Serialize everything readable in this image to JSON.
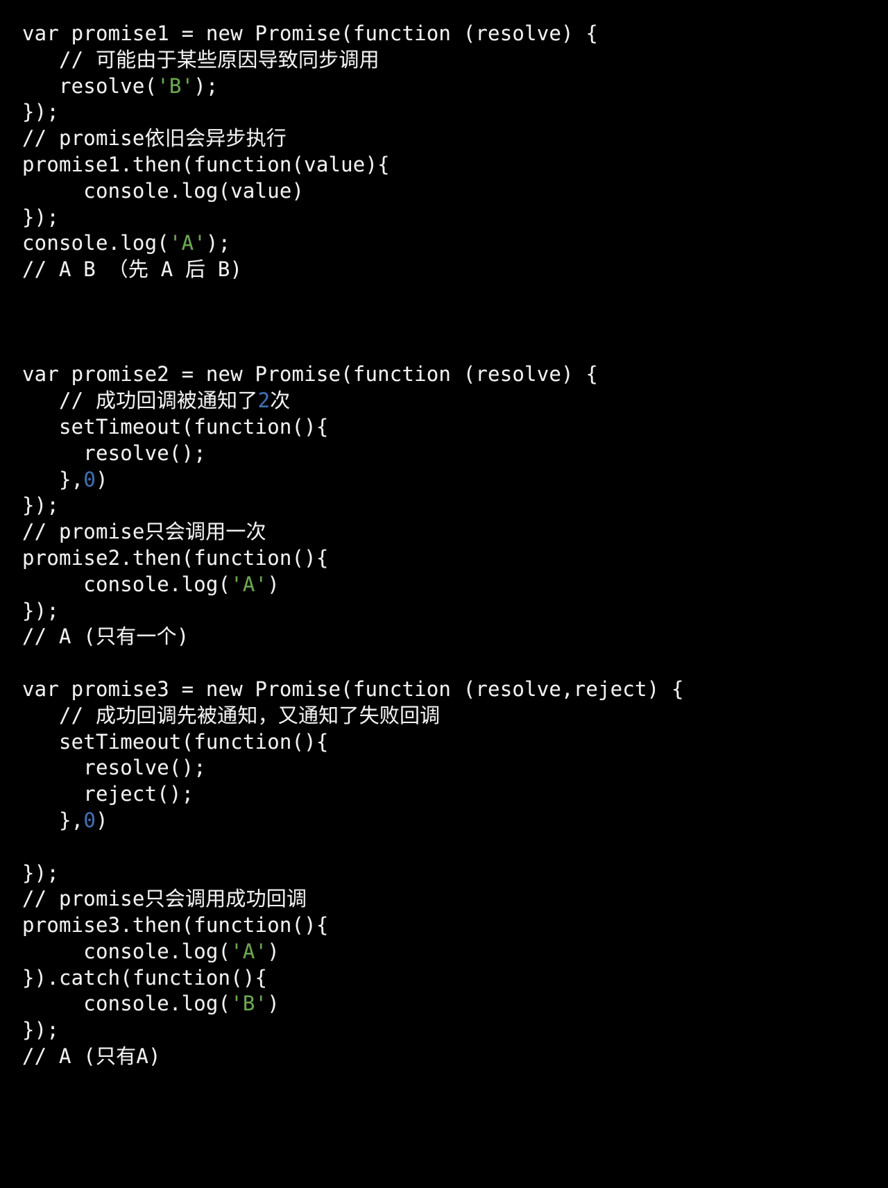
{
  "editor": {
    "background_color": "#000000",
    "foreground_color": "#f2f2f2",
    "string_color": "#6aa84f",
    "number_color": "#3d6fb5",
    "language": "javascript"
  },
  "code": {
    "lines": [
      {
        "id": "l1",
        "text": "var promise1 = new Promise(function (resolve) {"
      },
      {
        "id": "l2",
        "text": "   // 可能由于某些原因导致同步调用"
      },
      {
        "id": "l3",
        "text": "   resolve('B');",
        "segments": [
          {
            "t": "   resolve(",
            "k": "plain"
          },
          {
            "t": "'B'",
            "k": "str"
          },
          {
            "t": ");",
            "k": "plain"
          }
        ]
      },
      {
        "id": "l4",
        "text": "});"
      },
      {
        "id": "l5",
        "text": "// promise依旧会异步执行"
      },
      {
        "id": "l6",
        "text": "promise1.then(function(value){"
      },
      {
        "id": "l7",
        "text": "     console.log(value)"
      },
      {
        "id": "l8",
        "text": "});"
      },
      {
        "id": "l9",
        "text": "console.log('A');",
        "segments": [
          {
            "t": "console.log(",
            "k": "plain"
          },
          {
            "t": "'A'",
            "k": "str"
          },
          {
            "t": ");",
            "k": "plain"
          }
        ]
      },
      {
        "id": "l10",
        "text": "// A B （先 A 后 B)"
      },
      {
        "id": "l11",
        "text": ""
      },
      {
        "id": "l12",
        "text": ""
      },
      {
        "id": "l13",
        "text": ""
      },
      {
        "id": "l14",
        "text": "var promise2 = new Promise(function (resolve) {"
      },
      {
        "id": "l15",
        "text": "   // 成功回调被通知了2次",
        "segments": [
          {
            "t": "   // 成功回调被通知了",
            "k": "plain"
          },
          {
            "t": "2",
            "k": "num"
          },
          {
            "t": "次",
            "k": "plain"
          }
        ]
      },
      {
        "id": "l16",
        "text": "   setTimeout(function(){"
      },
      {
        "id": "l17",
        "text": "     resolve();"
      },
      {
        "id": "l18",
        "text": "   },0)",
        "segments": [
          {
            "t": "   },",
            "k": "plain"
          },
          {
            "t": "0",
            "k": "num"
          },
          {
            "t": ")",
            "k": "plain"
          }
        ]
      },
      {
        "id": "l19",
        "text": "});"
      },
      {
        "id": "l20",
        "text": "// promise只会调用一次"
      },
      {
        "id": "l21",
        "text": "promise2.then(function(){"
      },
      {
        "id": "l22",
        "text": "     console.log('A')",
        "segments": [
          {
            "t": "     console.log(",
            "k": "plain"
          },
          {
            "t": "'A'",
            "k": "str"
          },
          {
            "t": ")",
            "k": "plain"
          }
        ]
      },
      {
        "id": "l23",
        "text": "});"
      },
      {
        "id": "l24",
        "text": "// A (只有一个)"
      },
      {
        "id": "l25",
        "text": ""
      },
      {
        "id": "l26",
        "text": "var promise3 = new Promise(function (resolve,reject) {"
      },
      {
        "id": "l27",
        "text": "   // 成功回调先被通知，又通知了失败回调"
      },
      {
        "id": "l28",
        "text": "   setTimeout(function(){"
      },
      {
        "id": "l29",
        "text": "     resolve();"
      },
      {
        "id": "l30",
        "text": "     reject();"
      },
      {
        "id": "l31",
        "text": "   },0)",
        "segments": [
          {
            "t": "   },",
            "k": "plain"
          },
          {
            "t": "0",
            "k": "num"
          },
          {
            "t": ")",
            "k": "plain"
          }
        ]
      },
      {
        "id": "l32",
        "text": ""
      },
      {
        "id": "l33",
        "text": "});"
      },
      {
        "id": "l34",
        "text": "// promise只会调用成功回调"
      },
      {
        "id": "l35",
        "text": "promise3.then(function(){"
      },
      {
        "id": "l36",
        "text": "     console.log('A')",
        "segments": [
          {
            "t": "     console.log(",
            "k": "plain"
          },
          {
            "t": "'A'",
            "k": "str"
          },
          {
            "t": ")",
            "k": "plain"
          }
        ]
      },
      {
        "id": "l37",
        "text": "}).catch(function(){"
      },
      {
        "id": "l38",
        "text": "     console.log('B')",
        "segments": [
          {
            "t": "     console.log(",
            "k": "plain"
          },
          {
            "t": "'B'",
            "k": "str"
          },
          {
            "t": ")",
            "k": "plain"
          }
        ]
      },
      {
        "id": "l39",
        "text": "});"
      },
      {
        "id": "l40",
        "text": "// A (只有A)"
      }
    ]
  }
}
